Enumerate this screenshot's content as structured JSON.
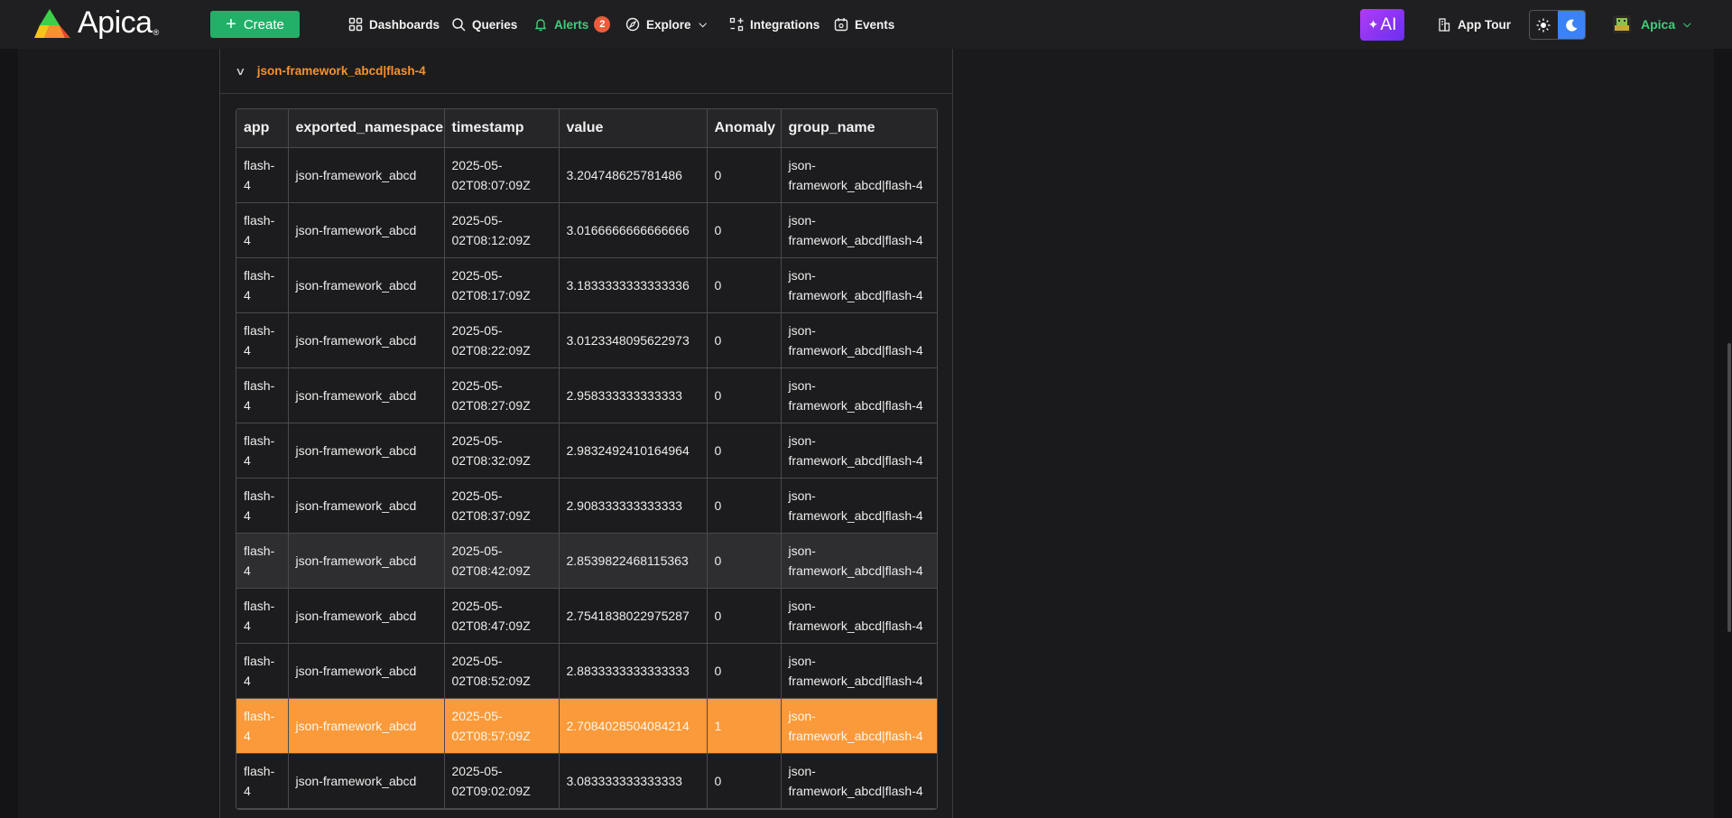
{
  "app": {
    "brand": "Apica",
    "brand_mark": "®",
    "accent_green": "#22b068",
    "accent_orange": "#fa9a3a"
  },
  "topbar": {
    "create_label": "Create",
    "nav": [
      {
        "label": "Dashboards",
        "icon": "dashboards-icon"
      },
      {
        "label": "Queries",
        "icon": "queries-icon"
      },
      {
        "label": "Alerts",
        "icon": "bell-icon",
        "badge": "2"
      },
      {
        "label": "Explore",
        "icon": "compass-icon"
      },
      {
        "label": "Integrations",
        "icon": "integrations-icon"
      },
      {
        "label": "Events",
        "icon": "events-icon"
      }
    ],
    "ai_label": "AI",
    "tour_label": "App Tour",
    "user_label": "Apica"
  },
  "group": {
    "title": "json-framework_abcd|flash-4"
  },
  "table": {
    "columns": [
      "app",
      "exported_namespace",
      "timestamp",
      "value",
      "Anomaly",
      "group_name"
    ],
    "rows": [
      {
        "app": "flash-4",
        "ns": "json-framework_abcd",
        "ts": "2025-05-02T08:07:09Z",
        "value": "3.204748625781486",
        "anomaly": "0",
        "group": "json-framework_abcd|flash-4"
      },
      {
        "app": "flash-4",
        "ns": "json-framework_abcd",
        "ts": "2025-05-02T08:12:09Z",
        "value": "3.0166666666666666",
        "anomaly": "0",
        "group": "json-framework_abcd|flash-4"
      },
      {
        "app": "flash-4",
        "ns": "json-framework_abcd",
        "ts": "2025-05-02T08:17:09Z",
        "value": "3.1833333333333336",
        "anomaly": "0",
        "group": "json-framework_abcd|flash-4"
      },
      {
        "app": "flash-4",
        "ns": "json-framework_abcd",
        "ts": "2025-05-02T08:22:09Z",
        "value": "3.0123348095622973",
        "anomaly": "0",
        "group": "json-framework_abcd|flash-4"
      },
      {
        "app": "flash-4",
        "ns": "json-framework_abcd",
        "ts": "2025-05-02T08:27:09Z",
        "value": "2.958333333333333",
        "anomaly": "0",
        "group": "json-framework_abcd|flash-4"
      },
      {
        "app": "flash-4",
        "ns": "json-framework_abcd",
        "ts": "2025-05-02T08:32:09Z",
        "value": "2.9832492410164964",
        "anomaly": "0",
        "group": "json-framework_abcd|flash-4"
      },
      {
        "app": "flash-4",
        "ns": "json-framework_abcd",
        "ts": "2025-05-02T08:37:09Z",
        "value": "2.908333333333333",
        "anomaly": "0",
        "group": "json-framework_abcd|flash-4"
      },
      {
        "app": "flash-4",
        "ns": "json-framework_abcd",
        "ts": "2025-05-02T08:42:09Z",
        "value": "2.8539822468115363",
        "anomaly": "0",
        "group": "json-framework_abcd|flash-4",
        "hover": true
      },
      {
        "app": "flash-4",
        "ns": "json-framework_abcd",
        "ts": "2025-05-02T08:47:09Z",
        "value": "2.7541838022975287",
        "anomaly": "0",
        "group": "json-framework_abcd|flash-4"
      },
      {
        "app": "flash-4",
        "ns": "json-framework_abcd",
        "ts": "2025-05-02T08:52:09Z",
        "value": "2.8833333333333333",
        "anomaly": "0",
        "group": "json-framework_abcd|flash-4"
      },
      {
        "app": "flash-4",
        "ns": "json-framework_abcd",
        "ts": "2025-05-02T08:57:09Z",
        "value": "2.7084028504084214",
        "anomaly": "1",
        "group": "json-framework_abcd|flash-4",
        "highlight": true
      },
      {
        "app": "flash-4",
        "ns": "json-framework_abcd",
        "ts": "2025-05-02T09:02:09Z",
        "value": "3.083333333333333",
        "anomaly": "0",
        "group": "json-framework_abcd|flash-4"
      }
    ]
  }
}
